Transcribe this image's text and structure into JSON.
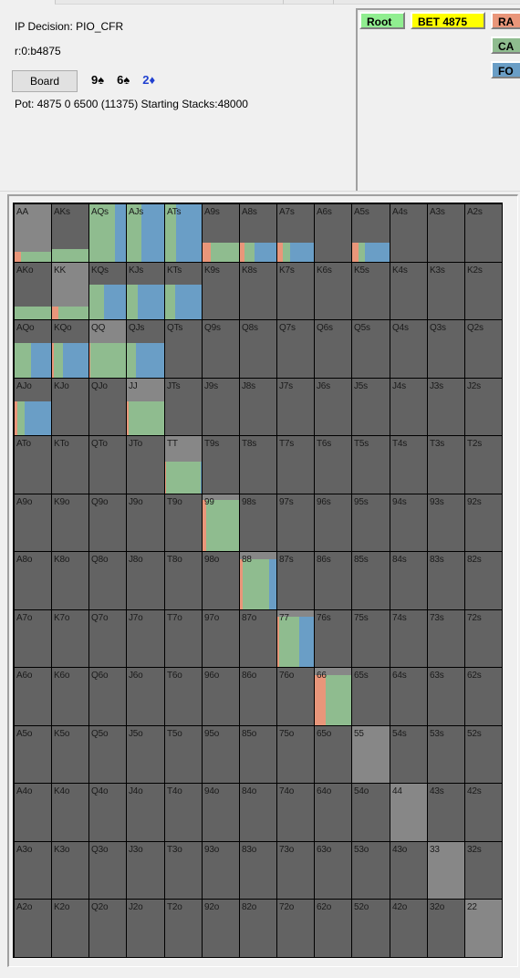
{
  "header": {
    "title": "IP Decision:  PIO_CFR",
    "line": "r:0:b4875",
    "board_button": "Board",
    "board_cards": [
      {
        "rank": "9",
        "suit": "♠",
        "color": "black"
      },
      {
        "rank": "6",
        "suit": "♠",
        "color": "black"
      },
      {
        "rank": "2",
        "suit": "♦",
        "color": "blue"
      }
    ],
    "pot_info": "Pot: 4875 0 6500 (11375) Starting Stacks:48000"
  },
  "tree": {
    "root": "Root",
    "bet": "BET 4875",
    "actions": [
      {
        "label": "RA",
        "action": "raise",
        "color": "#e9967a"
      },
      {
        "label": "CA",
        "action": "call",
        "color": "#8fbc8f"
      },
      {
        "label": "FO",
        "action": "fold",
        "color": "#6a9ec6"
      }
    ]
  },
  "colors": {
    "raise": "#e9967a",
    "call": "#8fbc8f",
    "fold": "#6a9ec6",
    "cell_bg": "#636363",
    "pair_bg": "#878787",
    "root_node": "#90ee90",
    "bet_node": "#ffff00"
  },
  "ranks": [
    "A",
    "K",
    "Q",
    "J",
    "T",
    "9",
    "8",
    "7",
    "6",
    "5",
    "4",
    "3",
    "2"
  ],
  "strategy": {
    "AA": {
      "weight": 0.18,
      "raise": 0.18,
      "call": 0.82,
      "fold": 0
    },
    "AKs": {
      "weight": 0.22,
      "raise": 0,
      "call": 1.0,
      "fold": 0
    },
    "AQs": {
      "weight": 1.0,
      "raise": 0,
      "call": 0.7,
      "fold": 0.3
    },
    "AJs": {
      "weight": 1.0,
      "raise": 0,
      "call": 0.4,
      "fold": 0.6
    },
    "ATs": {
      "weight": 1.0,
      "raise": 0,
      "call": 0.3,
      "fold": 0.7
    },
    "A9s": {
      "weight": 0.33,
      "raise": 0.23,
      "call": 0.77,
      "fold": 0
    },
    "A8s": {
      "weight": 0.33,
      "raise": 0.13,
      "call": 0.27,
      "fold": 0.6
    },
    "A7s": {
      "weight": 0.33,
      "raise": 0.16,
      "call": 0.2,
      "fold": 0.64
    },
    "A5s": {
      "weight": 0.33,
      "raise": 0.16,
      "call": 0.18,
      "fold": 0.66
    },
    "AKo": {
      "weight": 0.22,
      "raise": 0,
      "call": 1.0,
      "fold": 0
    },
    "KK": {
      "weight": 0.22,
      "raise": 0.18,
      "call": 0.82,
      "fold": 0
    },
    "KQs": {
      "weight": 0.62,
      "raise": 0,
      "call": 0.4,
      "fold": 0.6
    },
    "KJs": {
      "weight": 0.62,
      "raise": 0,
      "call": 0.3,
      "fold": 0.7
    },
    "KTs": {
      "weight": 0.62,
      "raise": 0,
      "call": 0.28,
      "fold": 0.72
    },
    "AQo": {
      "weight": 0.6,
      "raise": 0,
      "call": 0.45,
      "fold": 0.55
    },
    "KQo": {
      "weight": 0.6,
      "raise": 0.05,
      "call": 0.25,
      "fold": 0.7
    },
    "QQ": {
      "weight": 0.6,
      "raise": 0.03,
      "call": 0.97,
      "fold": 0
    },
    "QJs": {
      "weight": 0.6,
      "raise": 0,
      "call": 0.25,
      "fold": 0.75
    },
    "AJo": {
      "weight": 0.6,
      "raise": 0.08,
      "call": 0.2,
      "fold": 0.72
    },
    "JJ": {
      "weight": 0.6,
      "raise": 0.04,
      "call": 0.96,
      "fold": 0
    },
    "TT": {
      "weight": 0.55,
      "raise": 0.02,
      "call": 0.96,
      "fold": 0.02
    },
    "99": {
      "weight": 0.9,
      "raise": 0.1,
      "call": 0.9,
      "fold": 0
    },
    "88": {
      "weight": 0.88,
      "raise": 0.08,
      "call": 0.72,
      "fold": 0.2
    },
    "77": {
      "weight": 0.88,
      "raise": 0.06,
      "call": 0.55,
      "fold": 0.39
    },
    "66": {
      "weight": 0.88,
      "raise": 0.3,
      "call": 0.7,
      "fold": 0
    }
  }
}
